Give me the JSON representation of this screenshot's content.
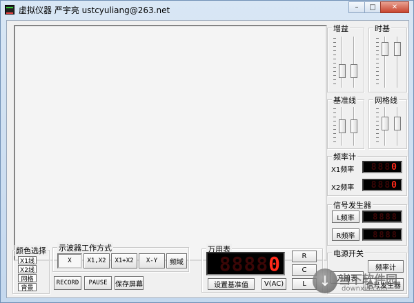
{
  "window": {
    "title": "虚拟仪器  严宇亮  ustcyuliang@263.net",
    "minimize_glyph": "–",
    "restore_glyph": "□",
    "close_glyph": "✕"
  },
  "panels": {
    "gain": "增益",
    "timebase": "时基",
    "baseline": "基准线",
    "grid": "网格线"
  },
  "freq_counter": {
    "title": "频率计",
    "x1_label": "X1频率",
    "x2_label": "X2频率",
    "x1_value": "0",
    "x2_value": "0"
  },
  "signal_gen": {
    "title": "信号发生器",
    "l_freq": "L频率",
    "r_freq": "R频率"
  },
  "color_select": {
    "title": "颜色选择",
    "items": [
      "X1线",
      "X2线",
      "网格",
      "背景"
    ]
  },
  "scope_mode": {
    "title": "示波器工作方式",
    "modes": [
      "X",
      "X1,X2",
      "X1+X2",
      "X-Y",
      "频域"
    ],
    "record": "RECORD",
    "pause": "PAUSE",
    "save_screen": "保存屏幕"
  },
  "multimeter": {
    "title": "万用表",
    "value": "0",
    "r": "R",
    "c": "C",
    "l": "L",
    "set_baseline": "设置基准值",
    "mode": "V(AC)"
  },
  "power": {
    "title": "电源开关",
    "multimeter": "万用表",
    "freq_counter": "频率计",
    "signal_gen": "信号发生器"
  },
  "watermark": {
    "text": "当下软件园",
    "site": "downxia.com"
  }
}
